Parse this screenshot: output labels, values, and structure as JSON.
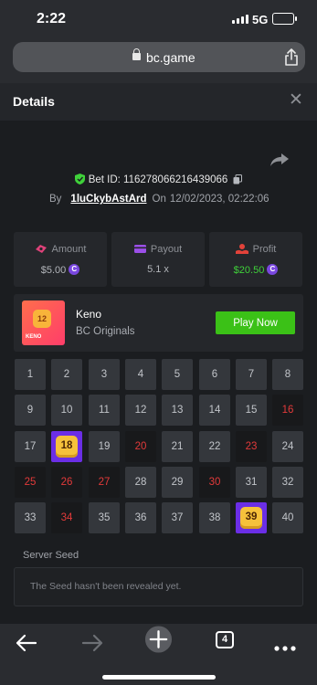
{
  "status_bar": {
    "time": "2:22",
    "network": "5G"
  },
  "browser": {
    "host": "bc.game",
    "tab_count": "4"
  },
  "details": {
    "title": "Details",
    "bet_id_label": "Bet ID: 116278066216439066",
    "by_label": "By",
    "username": "1luCkybAstArd",
    "on_label": "On",
    "date": "12/02/2023, 02:22:06"
  },
  "stats": {
    "amount": {
      "label": "Amount",
      "value": "$5.00"
    },
    "payout": {
      "label": "Payout",
      "value": "5.1 x"
    },
    "profit": {
      "label": "Profit",
      "value": "$20.50"
    }
  },
  "game": {
    "name": "Keno",
    "provider": "BC Originals",
    "thumb_number": "12",
    "thumb_word": "KENO",
    "play_label": "Play Now"
  },
  "keno": {
    "numbers": [
      "1",
      "2",
      "3",
      "4",
      "5",
      "6",
      "7",
      "8",
      "9",
      "10",
      "11",
      "12",
      "13",
      "14",
      "15",
      "16",
      "17",
      "18",
      "19",
      "20",
      "21",
      "22",
      "23",
      "24",
      "25",
      "26",
      "27",
      "28",
      "29",
      "30",
      "31",
      "32",
      "33",
      "34",
      "35",
      "36",
      "37",
      "38",
      "39",
      "40"
    ],
    "drawn": [
      16,
      20,
      23,
      25,
      26,
      27,
      30,
      34
    ],
    "hits": [
      18,
      39
    ]
  },
  "seed": {
    "label": "Server Seed",
    "message": "The Seed hasn't been revealed yet."
  },
  "colors": {
    "accent_green": "#3bc117",
    "hit_purple": "#6b2ee6",
    "drawn_red": "#e23a3a",
    "coin_purple": "#7a48e0"
  }
}
